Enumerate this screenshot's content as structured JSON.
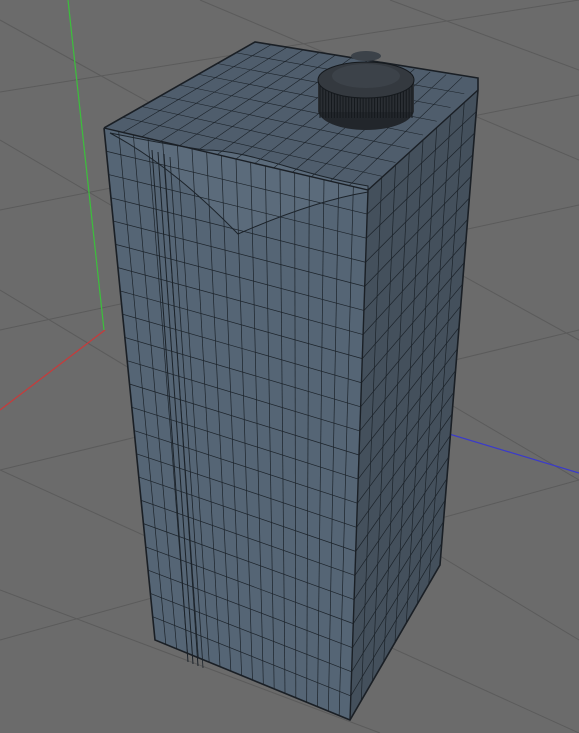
{
  "app": {
    "title": ""
  },
  "viewport": {
    "background_color": "#6b6b6b",
    "grid_color": "#5b5b5b",
    "axes": {
      "x_axis_color": "#c93a3a",
      "y_axis_color": "#3cbf3c",
      "z_axis_color": "#3a3acb"
    },
    "object": {
      "name": "",
      "shading": "wireframe-on-shaded",
      "body_color_front": "#556575",
      "body_color_side": "#44505c",
      "body_color_top": "#4f5d6c",
      "wire_color": "#1c232a",
      "cap_color": "#2a2e33",
      "cap_icon": "bottle-cap-icon"
    }
  }
}
